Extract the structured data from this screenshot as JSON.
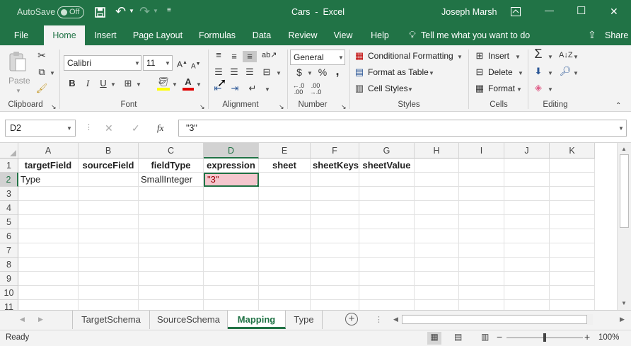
{
  "titlebar": {
    "autosave_label": "AutoSave",
    "autosave_state": "Off",
    "title": "Cars  -  Excel",
    "user": "Joseph Marsh",
    "minimize": "—",
    "restore": "☐",
    "close": "✕"
  },
  "tabs": [
    {
      "label": "File"
    },
    {
      "label": "Home"
    },
    {
      "label": "Insert"
    },
    {
      "label": "Page Layout"
    },
    {
      "label": "Formulas"
    },
    {
      "label": "Data"
    },
    {
      "label": "Review"
    },
    {
      "label": "View"
    },
    {
      "label": "Help"
    }
  ],
  "tell_me": "Tell me what you want to do",
  "share": "Share",
  "ribbon": {
    "clipboard": {
      "paste": "Paste",
      "label": "Clipboard"
    },
    "font": {
      "name": "Calibri",
      "size": "11",
      "bold": "B",
      "italic": "I",
      "underline": "U",
      "label": "Font"
    },
    "alignment": {
      "label": "Alignment"
    },
    "number": {
      "format": "General",
      "currency": "$",
      "percent": "%",
      "comma": ",",
      "label": "Number"
    },
    "styles": {
      "conditional": "Conditional Formatting",
      "table": "Format as Table",
      "cell_styles": "Cell Styles",
      "label": "Styles"
    },
    "cells": {
      "insert": "Insert",
      "delete": "Delete",
      "format": "Format",
      "label": "Cells"
    },
    "editing": {
      "label": "Editing"
    }
  },
  "formula_bar": {
    "name_box": "D2",
    "fx": "fx",
    "value": "\"3\""
  },
  "columns": [
    "A",
    "B",
    "C",
    "D",
    "E",
    "F",
    "G",
    "H",
    "I",
    "J",
    "K"
  ],
  "rows": [
    "1",
    "2",
    "3",
    "4",
    "5",
    "6",
    "7",
    "8",
    "9",
    "10",
    "11"
  ],
  "cells": {
    "header": [
      "targetField",
      "sourceField",
      "fieldType",
      "expression",
      "sheet",
      "sheetKeys",
      "sheetValue"
    ],
    "row2": {
      "A": "Type",
      "C": "SmallInteger",
      "D": "\"3\""
    }
  },
  "sheets": [
    {
      "label": "TargetSchema"
    },
    {
      "label": "SourceSchema"
    },
    {
      "label": "Mapping"
    },
    {
      "label": "Type"
    }
  ],
  "status": {
    "ready": "Ready",
    "zoom": "100%"
  },
  "colors": {
    "excel_green": "#217346",
    "selected_cell": "#f4c7ce",
    "selected_text": "#9c0006"
  }
}
